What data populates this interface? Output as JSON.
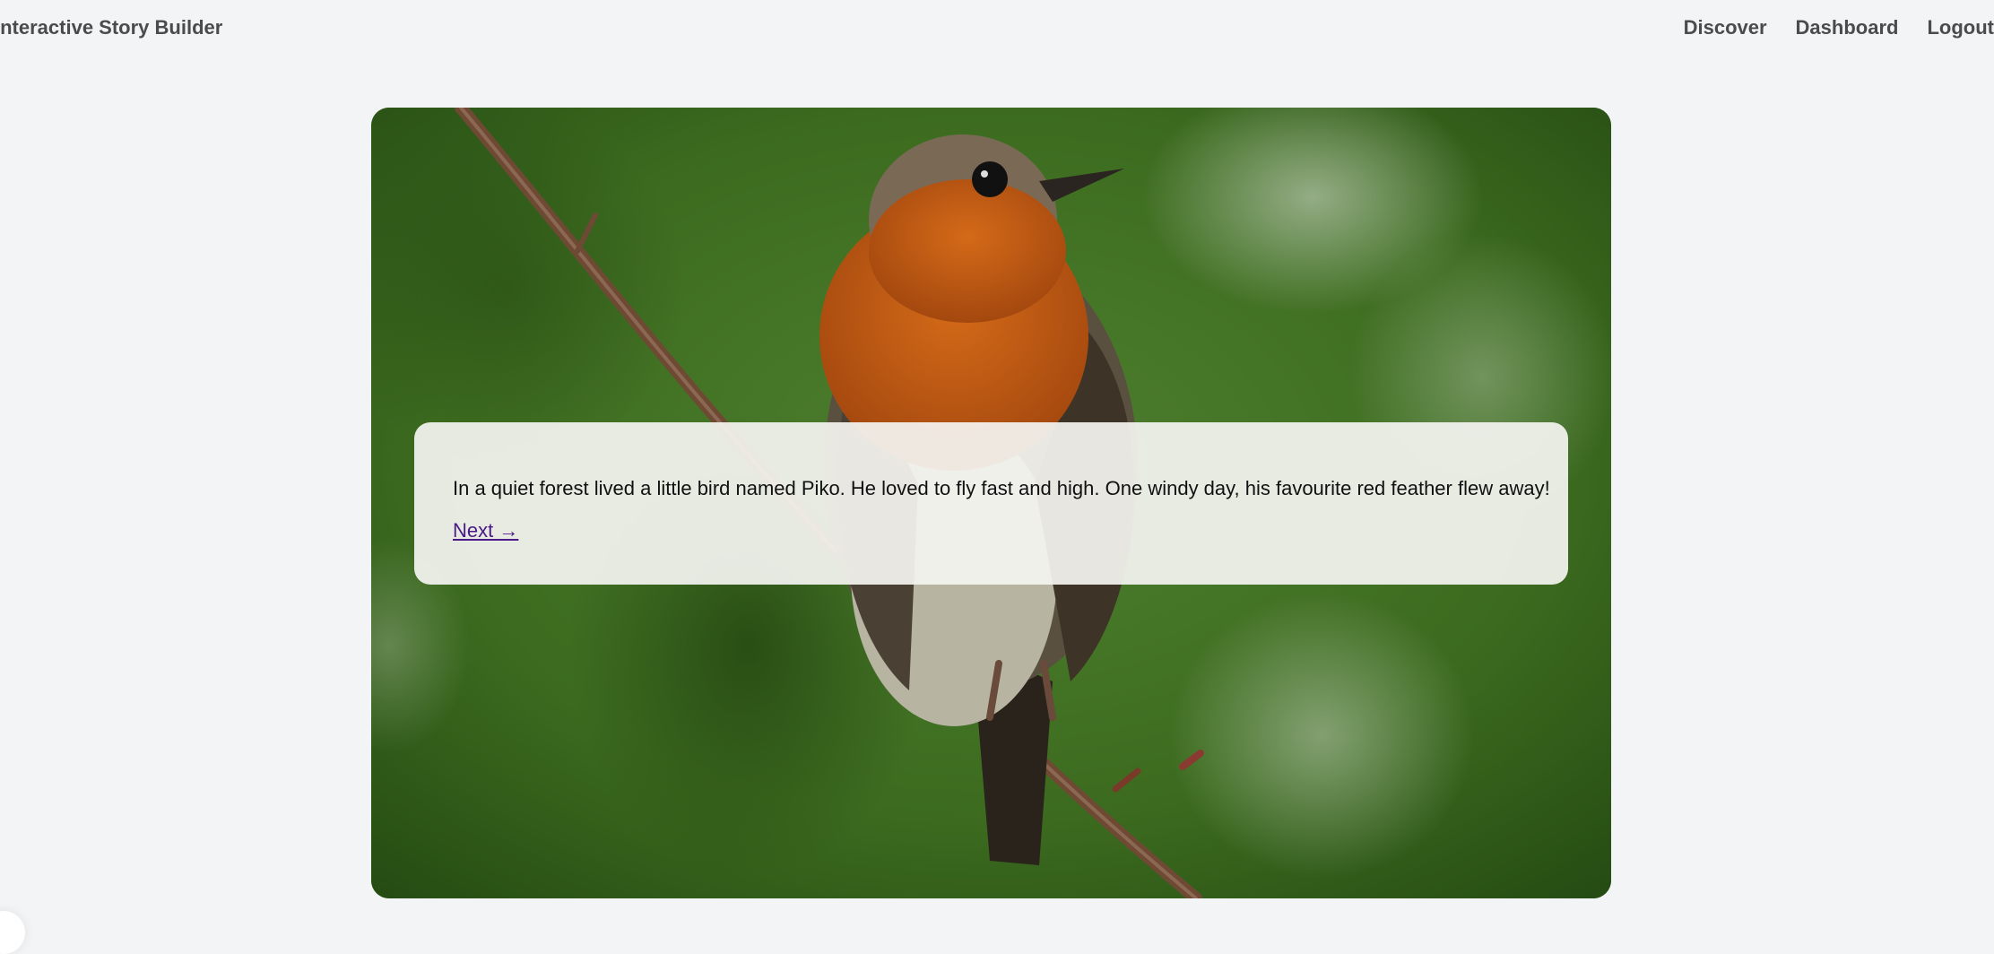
{
  "header": {
    "brand": "Interactive Story Builder",
    "nav": [
      {
        "label": "Discover"
      },
      {
        "label": "Dashboard"
      },
      {
        "label": "Logout"
      }
    ]
  },
  "story": {
    "page_text": "In a quiet forest lived a little bird named Piko. He loved to fly fast and high. One windy day, his favourite red feather flew away!",
    "next_label": "Next →"
  },
  "scene": {
    "image_subject": "robin-on-branch",
    "colors": {
      "background_green": "#3f6f24",
      "breast_orange": "#c25a14",
      "branch_brown": "#6e4a35"
    }
  }
}
